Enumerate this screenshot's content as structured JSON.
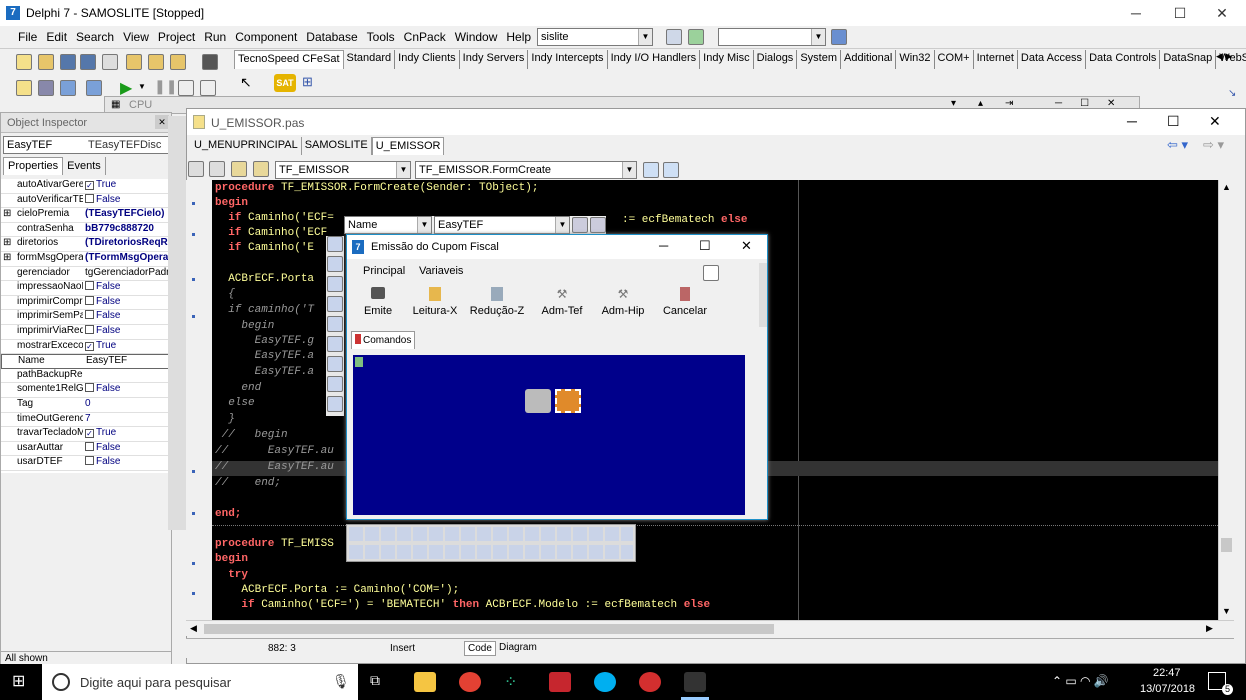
{
  "window": {
    "title": "Delphi 7 - SAMOSLITE [Stopped]",
    "minimize": "─",
    "maximize": "☐",
    "close": "✕"
  },
  "menu": [
    "File",
    "Edit",
    "Search",
    "View",
    "Project",
    "Run",
    "Component",
    "Database",
    "Tools",
    "CnPack",
    "Window",
    "Help"
  ],
  "toolbar": {
    "config_combo": "sislite",
    "desktop_combo": ""
  },
  "palette_tabs": [
    "TecnoSpeed CFeSat",
    "Standard",
    "Indy Clients",
    "Indy Servers",
    "Indy Intercepts",
    "Indy I/O Handlers",
    "Indy Misc",
    "Dialogs",
    "System",
    "Additional",
    "Win32",
    "COM+",
    "Internet",
    "Data Access",
    "Data Controls",
    "DataSnap",
    "WebSe"
  ],
  "cpu_window": {
    "title": "CPU"
  },
  "object_inspector": {
    "title": "Object Inspector",
    "object_name": "EasyTEF",
    "object_type": "TEasyTEFDisc",
    "tabs": [
      "Properties",
      "Events"
    ],
    "rows": [
      {
        "name": "autoAtivarGere",
        "value": "True",
        "check": true
      },
      {
        "name": "autoVerificarTE",
        "value": "False",
        "check": false
      },
      {
        "name": "cieloPremia",
        "value": "(TEasyTEFCielo)",
        "expand": true
      },
      {
        "name": "contraSenha",
        "value": "bB779c888720"
      },
      {
        "name": "diretorios",
        "value": "(TDiretoriosReqRes)",
        "expand": true
      },
      {
        "name": "formMsgOperac",
        "value": "(TFormMsgOpera)",
        "expand": true
      },
      {
        "name": "gerenciador",
        "value": "tgGerenciadorPadr"
      },
      {
        "name": "impressaoNaoF",
        "value": "False",
        "check": false
      },
      {
        "name": "imprimirCompro",
        "value": "False",
        "check": false
      },
      {
        "name": "imprimirSemPa",
        "value": "False",
        "check": false
      },
      {
        "name": "imprimirViaRedu",
        "value": "False",
        "check": false
      },
      {
        "name": "mostrarExcecoe",
        "value": "True",
        "check": true
      },
      {
        "name": "Name",
        "value": "EasyTEF"
      },
      {
        "name": "pathBackupRe",
        "value": ""
      },
      {
        "name": "somente1RelG",
        "value": "False",
        "check": false
      },
      {
        "name": "Tag",
        "value": "0"
      },
      {
        "name": "timeOutGerenc",
        "value": "7"
      },
      {
        "name": "travarTecladoM",
        "value": "True",
        "check": true
      },
      {
        "name": "usarAuttar",
        "value": "False",
        "check": false
      },
      {
        "name": "usarDTEF",
        "value": "False",
        "check": false
      }
    ],
    "status": "All shown"
  },
  "editor": {
    "title": "U_EMISSOR.pas",
    "tabs": [
      "U_MENUPRINCIPAL",
      "SAMOSLITE",
      "U_EMISSOR"
    ],
    "class_combo": "TF_EMISSOR",
    "method_combo": "TF_EMISSOR.FormCreate",
    "status": {
      "position": "882:  3",
      "mode": "Insert",
      "tab_code": "Code",
      "tab_diagram": "Diagram"
    }
  },
  "form_designer": {
    "title": "Emissão do Cupom Fiscal",
    "name_combo": "Name",
    "value_combo": "EasyTEF",
    "menu": [
      "Principal",
      "Variaveis"
    ],
    "buttons": [
      "Emite",
      "Leitura-X",
      "Redução-Z",
      "Adm-Tef",
      "Adm-Hip",
      "Cancelar"
    ],
    "tab": "Comandos"
  },
  "taskbar": {
    "search": "Digite aqui para pesquisar",
    "time": "22:47",
    "date": "13/07/2018",
    "notif_count": "5"
  }
}
